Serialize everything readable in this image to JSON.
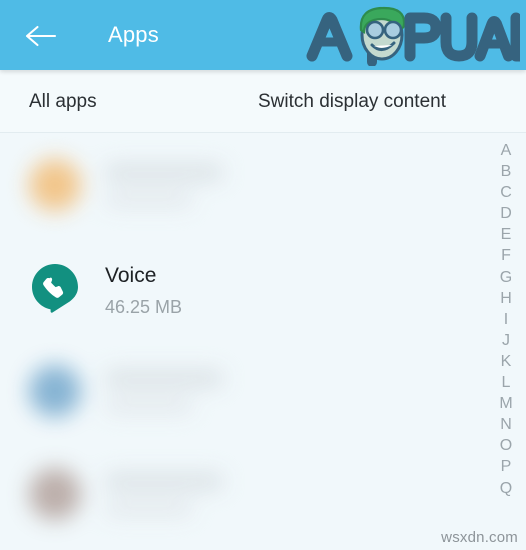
{
  "appbar": {
    "title": "Apps",
    "back_icon": "arrow-left-icon",
    "background_color": "#4fbbe6",
    "title_color": "#ffffff",
    "logo": {
      "text": "APPUALS",
      "wordmark_color": "#36637f",
      "hair_color": "#3aa85c",
      "face_color": "#c3d9cf"
    }
  },
  "tabs": [
    {
      "label": "All apps",
      "name": "tab-all-apps",
      "selected": true
    },
    {
      "label": "Switch display content",
      "name": "tab-switch-display-content",
      "selected": false
    }
  ],
  "list": {
    "rows": [
      {
        "kind": "blurred",
        "icon_color": "#f2c282",
        "name": "",
        "size": ""
      },
      {
        "kind": "app",
        "icon": "voice-phone-bubble-icon",
        "icon_color": "#129080",
        "name": "Voice",
        "size": "46.25 MB"
      },
      {
        "kind": "blurred",
        "icon_color": "#7eaed0",
        "name": "",
        "size": ""
      },
      {
        "kind": "blurred",
        "icon_color": "#b8a9a4",
        "name": "",
        "size": ""
      }
    ]
  },
  "alpha_index": {
    "name": "alphabet-scroll-index",
    "letters": [
      "A",
      "B",
      "C",
      "D",
      "E",
      "F",
      "G",
      "H",
      "I",
      "J",
      "K",
      "L",
      "M",
      "N",
      "O",
      "P",
      "Q"
    ]
  },
  "watermark": {
    "text": "wsxdn.com"
  },
  "colors": {
    "page_background": "#f1f8fb",
    "appbar": "#4fbbe6",
    "tabrow": "#f4fafc",
    "divider": "#e2ecf0",
    "primary_text": "#1d2124",
    "secondary_text": "#9aa3a8",
    "index_text": "#9ba5ab"
  }
}
